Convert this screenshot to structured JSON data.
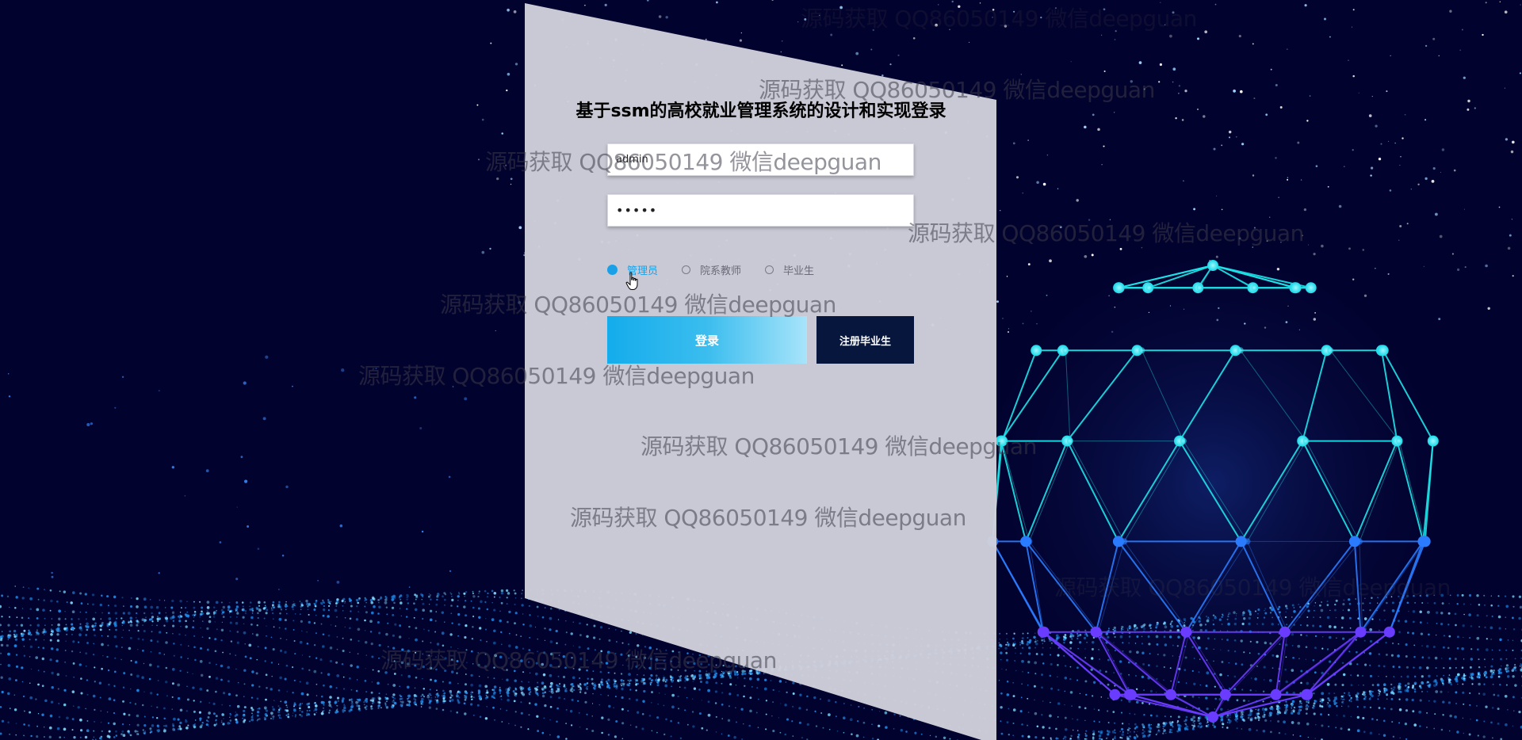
{
  "app": {
    "title": "基于ssm的高校就业管理系统的设计和实现登录"
  },
  "form": {
    "username_value": "admin",
    "password_value": "•••••",
    "roles": [
      {
        "label": "管理员",
        "selected": true
      },
      {
        "label": "院系教师",
        "selected": false
      },
      {
        "label": "毕业生",
        "selected": false
      }
    ],
    "login_label": "登录",
    "register_label": "注册毕业生"
  },
  "watermark": {
    "text": "源码获取 QQ86050149 微信deepguan"
  },
  "colors": {
    "background": "#02022e",
    "panel": "#cfcfdb",
    "accent": "#1aa0e6",
    "register_button": "#06163d"
  },
  "icons": {
    "cursor": "hand-pointer-icon",
    "radio": "radio-icon"
  }
}
